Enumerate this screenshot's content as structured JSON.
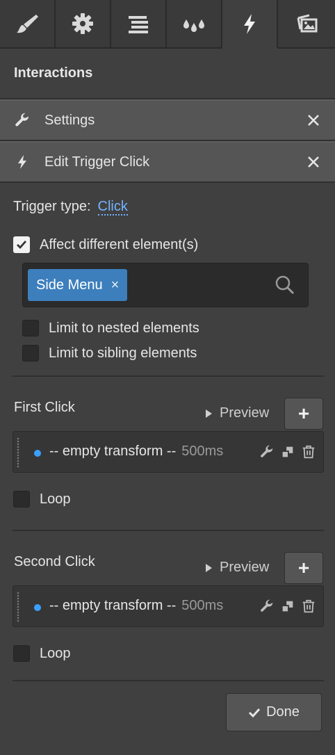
{
  "tabs": [
    {
      "icon": "brush-icon",
      "active": false
    },
    {
      "icon": "gear-icon",
      "active": false
    },
    {
      "icon": "navigator-icon",
      "active": false
    },
    {
      "icon": "droplets-icon",
      "active": false
    },
    {
      "icon": "bolt-icon",
      "active": true
    },
    {
      "icon": "assets-icon",
      "active": false
    }
  ],
  "section_title": "Interactions",
  "settings_bar": {
    "label": "Settings",
    "icon": "wrench-icon"
  },
  "edit_bar": {
    "label": "Edit Trigger Click",
    "icon": "bolt-icon"
  },
  "trigger": {
    "label": "Trigger type:",
    "value": "Click"
  },
  "affect": {
    "label": "Affect different element(s)",
    "checked": true
  },
  "selector": {
    "tag": "Side Menu",
    "tag_remove": "×"
  },
  "limit_nested": {
    "label": "Limit to nested elements",
    "checked": false
  },
  "limit_sibling": {
    "label": "Limit to sibling elements",
    "checked": false
  },
  "first_click": {
    "title": "First Click",
    "preview": "Preview",
    "add": "+",
    "action": {
      "text": "-- empty transform --",
      "duration": "500ms"
    },
    "loop": {
      "label": "Loop",
      "checked": false
    }
  },
  "second_click": {
    "title": "Second Click",
    "preview": "Preview",
    "add": "+",
    "action": {
      "text": "-- empty transform --",
      "duration": "500ms"
    },
    "loop": {
      "label": "Loop",
      "checked": false
    }
  },
  "done": {
    "label": "Done"
  },
  "colors": {
    "accent": "#74b3ff",
    "tag": "#3c7fbc",
    "dot": "#3aa0ff",
    "panel": "#404040"
  }
}
